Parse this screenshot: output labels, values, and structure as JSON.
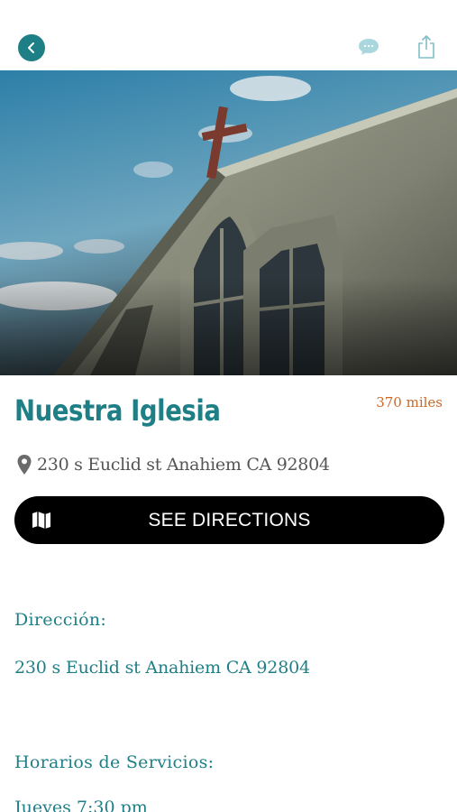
{
  "header": {
    "back_icon": "chevron-left-icon",
    "chat_icon": "chat-bubble-icon",
    "share_icon": "share-icon",
    "accent_color": "#1f7f86"
  },
  "hero": {
    "image_subject": "church facade with cross under blue sky"
  },
  "church": {
    "name": "Nuestra Iglesia",
    "distance": "370 miles",
    "address": "230 s Euclid st Anahiem CA 92804"
  },
  "directions": {
    "label": "SEE DIRECTIONS",
    "icon": "map-icon"
  },
  "details": {
    "address_label": "Dirección:",
    "address_value": "230 s Euclid st Anahiem CA 92804",
    "schedule_label": "Horarios de Servicios:",
    "schedule_first_line": "Jueves 7:30 pm"
  }
}
